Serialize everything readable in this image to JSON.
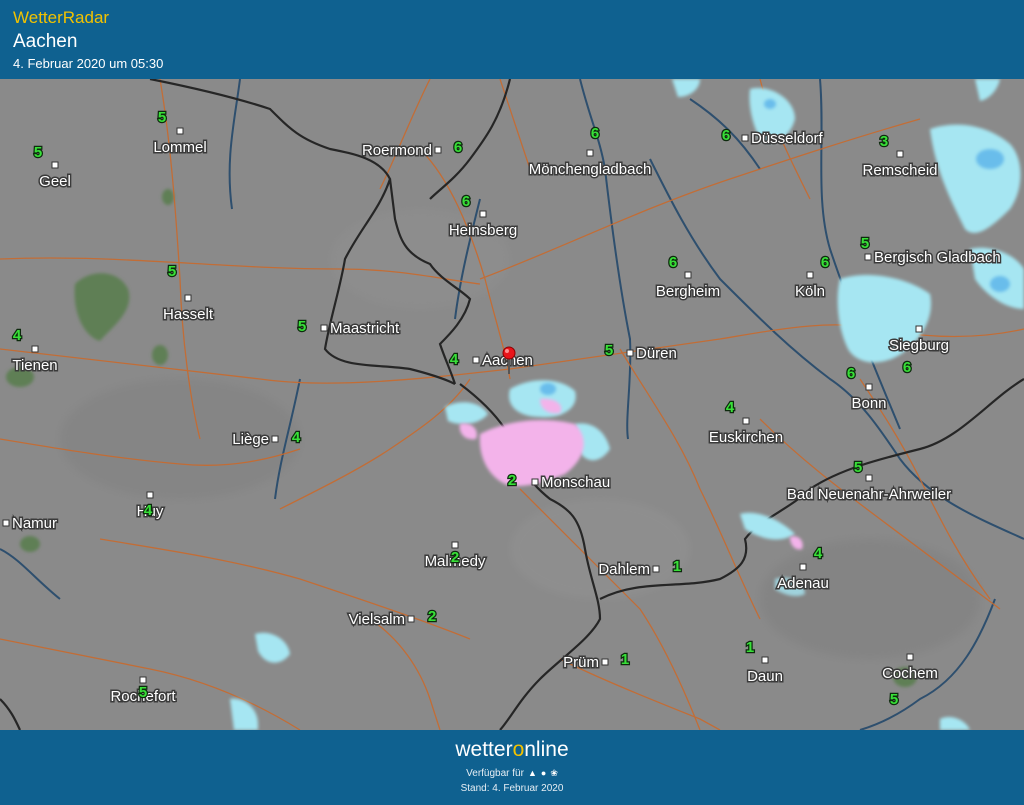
{
  "header": {
    "app_title": "WetterRadar",
    "location": "Aachen",
    "timestamp": "4. Februar 2020 um 05:30"
  },
  "map": {
    "cities": [
      {
        "name": "Lommel",
        "value": "5"
      },
      {
        "name": "Geel",
        "value": "5"
      },
      {
        "name": "Roermond",
        "value": "6"
      },
      {
        "name": "Mönchengladbach",
        "value": "6"
      },
      {
        "name": "Düsseldorf",
        "value": "6"
      },
      {
        "name": "Remscheid",
        "value": "3"
      },
      {
        "name": "Heinsberg",
        "value": "6"
      },
      {
        "name": "Hasselt",
        "value": "5"
      },
      {
        "name": "Bergheim",
        "value": "6"
      },
      {
        "name": "Köln",
        "value": "6"
      },
      {
        "name": "Bergisch Gladbach",
        "value": "5"
      },
      {
        "name": "Maastricht",
        "value": "5"
      },
      {
        "name": "Tienen",
        "value": "4"
      },
      {
        "name": "Aachen",
        "value": "4"
      },
      {
        "name": "Düren",
        "value": "5"
      },
      {
        "name": "Siegburg",
        "value": "6"
      },
      {
        "name": "Bonn",
        "value": "6"
      },
      {
        "name": "Liège",
        "value": "4"
      },
      {
        "name": "Euskirchen",
        "value": "4"
      },
      {
        "name": "Huy",
        "value": "4"
      },
      {
        "name": "Monschau",
        "value": "2"
      },
      {
        "name": "Bad Neuenahr-Ahrweiler",
        "value": "5"
      },
      {
        "name": "Namur",
        "value": ""
      },
      {
        "name": "Malmedy",
        "value": "2"
      },
      {
        "name": "Dahlem",
        "value": "1"
      },
      {
        "name": "Adenau",
        "value": "4"
      },
      {
        "name": "Vielsalm",
        "value": "2"
      },
      {
        "name": "Rochefort",
        "value": "5"
      },
      {
        "name": "Prüm",
        "value": "1"
      },
      {
        "name": "Daun",
        "value": "1"
      },
      {
        "name": "Cochem",
        "value": "5"
      }
    ],
    "colors": {
      "background": "#8a8a8a",
      "border": "#262626",
      "road": "#c96a2d",
      "river": "#2e4f6e",
      "rain_light": "#a6e6f2",
      "snow": "#f3b3ea",
      "green": "#5e7f55"
    }
  },
  "footer": {
    "brand_pre": "wetter",
    "brand_o": "o",
    "brand_post": "nline",
    "available": "Verfügbar für",
    "platforms": [
      "android-icon",
      "apple-icon",
      "windows-icon"
    ],
    "updated": "Stand: 4. Februar 2020"
  }
}
